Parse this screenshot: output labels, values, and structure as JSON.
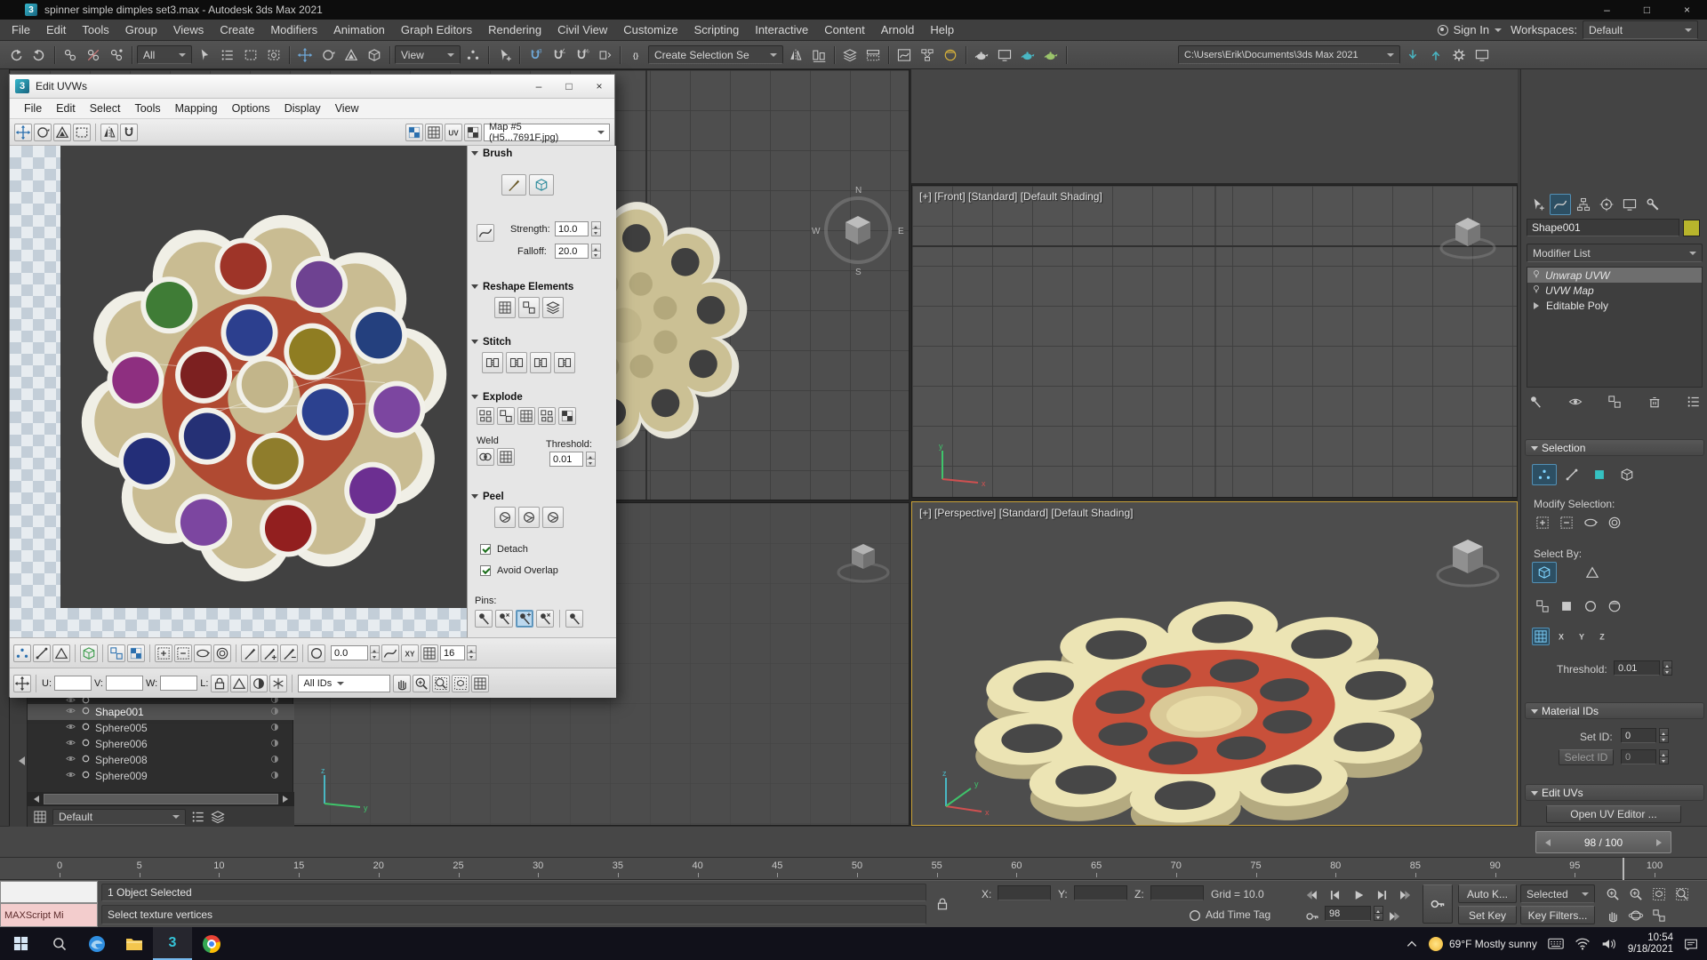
{
  "window_controls": {
    "minimize": "–",
    "maximize": "□",
    "close": "×"
  },
  "titlebar": {
    "title": "spinner simple dimples set3.max - Autodesk 3ds Max 2021",
    "app_badge": "3"
  },
  "menubar": {
    "items": [
      "File",
      "Edit",
      "Tools",
      "Group",
      "Views",
      "Create",
      "Modifiers",
      "Animation",
      "Graph Editors",
      "Rendering",
      "Civil View",
      "Customize",
      "Scripting",
      "Interactive",
      "Content",
      "Arnold",
      "Help"
    ],
    "sign_in": "Sign In",
    "workspaces_label": "Workspaces:",
    "workspaces_value": "Default"
  },
  "toolbar": {
    "filter_value": "All",
    "coord_value": "View",
    "named_sel_value": "Create Selection Se",
    "path_value": "C:\\Users\\Erik\\Documents\\3ds Max 2021",
    "strip_a": [
      {
        "n": "undo-icon",
        "g": "undo"
      },
      {
        "n": "redo-icon",
        "g": "redo"
      },
      {
        "sep": 1
      },
      {
        "n": "select-and-link-icon",
        "g": "chain"
      },
      {
        "n": "unlink-selection-icon",
        "g": "chainx"
      },
      {
        "n": "bind-spacewarp-icon",
        "g": "chaindot"
      },
      {
        "sep": 1
      }
    ],
    "strip_b": [
      {
        "n": "select-object-icon",
        "g": "cursor"
      },
      {
        "n": "select-by-name-icon",
        "g": "list3"
      },
      {
        "n": "rect-region-icon",
        "g": "rectdash"
      },
      {
        "n": "crossing-region-icon",
        "g": "rectcross"
      },
      {
        "sep": 1
      },
      {
        "n": "select-move-icon",
        "g": "move",
        "c": "#6fa8d8"
      },
      {
        "n": "select-rotate-icon",
        "g": "rotate"
      },
      {
        "n": "select-scale-icon",
        "g": "scale"
      },
      {
        "n": "select-place-icon",
        "g": "cube"
      },
      {
        "sep": 1
      }
    ],
    "strip_c": [
      {
        "n": "use-center-icon",
        "g": "dots3"
      },
      {
        "sep": 1
      },
      {
        "n": "select-manipulate-icon",
        "g": "cursorplus"
      },
      {
        "sep": 1
      },
      {
        "n": "snap-3d-icon",
        "g": "magnet",
        "t": "3",
        "c": "#6fa8d8"
      },
      {
        "n": "angle-snap-icon",
        "g": "magnet",
        "t": "∠"
      },
      {
        "n": "percent-snap-icon",
        "g": "magnet",
        "t": "%"
      },
      {
        "n": "spinner-snap-icon",
        "g": "spinner"
      },
      {
        "sep": 1
      },
      {
        "n": "edit-named-selections-icon",
        "g": "txt",
        "t": "{}"
      }
    ],
    "strip_d": [
      {
        "n": "mirror-icon",
        "g": "mirror"
      },
      {
        "n": "align-icon",
        "g": "align"
      },
      {
        "sep": 1
      },
      {
        "n": "layer-explorer-icon",
        "g": "layers"
      },
      {
        "n": "toggle-ribbon-icon",
        "g": "ribbon"
      },
      {
        "sep": 1
      },
      {
        "n": "curve-editor-icon",
        "g": "graph"
      },
      {
        "n": "schematic-view-icon",
        "g": "schematic"
      },
      {
        "n": "material-editor-icon",
        "g": "matsphere",
        "c": "#d8b23a"
      },
      {
        "sep": 1
      },
      {
        "n": "render-setup-icon",
        "g": "teapot"
      },
      {
        "n": "rendered-frame-window-icon",
        "g": "screen"
      },
      {
        "n": "render-production-icon",
        "g": "teapot",
        "c": "#49b7c4"
      },
      {
        "n": "render-iterative-icon",
        "g": "teapot",
        "c": "#9bc46b"
      },
      {
        "sep": 1
      }
    ],
    "strip_e": [
      {
        "n": "asset-library-icon",
        "g": "arrowd",
        "c": "#49b7c4"
      },
      {
        "n": "cloud-sync-icon",
        "g": "arrowu",
        "c": "#49b7c4"
      },
      {
        "n": "preferences-icon",
        "g": "gear"
      },
      {
        "n": "display-monitor-icon",
        "g": "screen"
      }
    ]
  },
  "viewports": {
    "front_label": "[+] [Front] [Standard] [Default Shading]",
    "persp_label": "[+] [Perspective] [Standard] [Default Shading]",
    "compass": {
      "n": "N",
      "e": "E",
      "s": "S",
      "w": "W"
    },
    "axis": {
      "x": "x",
      "y": "y",
      "z": "z"
    }
  },
  "edit_uvws": {
    "title": "Edit UVWs",
    "menus": [
      "File",
      "Edit",
      "Select",
      "Tools",
      "Mapping",
      "Options",
      "Display",
      "View"
    ],
    "map_value": "Map #5 (H5...7691F.jpg)",
    "tools_left": [
      {
        "n": "uv-move-icon",
        "g": "move",
        "c": "#2a6fae"
      },
      {
        "n": "uv-rotate-icon",
        "g": "rotate"
      },
      {
        "n": "uv-scale-icon",
        "g": "scale"
      },
      {
        "n": "uv-freeform-icon",
        "g": "rectdash"
      },
      {
        "sep": 1
      },
      {
        "n": "uv-mirror-icon",
        "g": "mirror"
      },
      {
        "n": "uv-snap-icon",
        "g": "magnet"
      }
    ],
    "tools_right": [
      {
        "n": "show-map-toggle-icon",
        "g": "checker",
        "c": "#2a6fae"
      },
      {
        "n": "uv-grid-toggle-icon",
        "g": "grid9"
      },
      {
        "n": "uv-space-button",
        "g": "txt",
        "t": "UV"
      },
      {
        "n": "texture-checker-icon",
        "g": "checker"
      }
    ],
    "brush": {
      "title": "Brush",
      "icons": [
        {
          "n": "move-brush-icon",
          "g": "brush",
          "c": "#6a5a2a"
        },
        {
          "n": "relax-brush-icon",
          "g": "cube",
          "c": "#2a8a9b"
        }
      ],
      "falloff_icon": [
        {
          "n": "brush-falloff-curve-icon",
          "g": "curve"
        }
      ],
      "strength_label": "Strength:",
      "strength_value": "10.0",
      "falloff_label": "Falloff:",
      "falloff_value": "20.0"
    },
    "reshape": {
      "title": "Reshape Elements",
      "icons": [
        {
          "n": "straighten-selection-icon",
          "g": "grid9"
        },
        {
          "n": "relax-until-flat-icon",
          "g": "cubes"
        },
        {
          "n": "relax-tool-icon",
          "g": "layers"
        }
      ]
    },
    "stitch": {
      "title": "Stitch",
      "icons": [
        {
          "n": "stitch-custom-icon",
          "g": "stitch"
        },
        {
          "n": "stitch-average-icon",
          "g": "stitch"
        },
        {
          "n": "stitch-source-icon",
          "g": "stitch"
        },
        {
          "n": "stitch-target-icon",
          "g": "stitch"
        }
      ]
    },
    "explode": {
      "title": "Explode",
      "icons": [
        {
          "n": "break-by-angle-icon",
          "g": "explode"
        },
        {
          "n": "break-icon",
          "g": "cubes"
        },
        {
          "n": "detach-icon",
          "g": "grid9"
        },
        {
          "n": "flatten-by-angle-icon",
          "g": "explode"
        },
        {
          "n": "flatten-by-smoothing-icon",
          "g": "checker"
        }
      ],
      "weld_label": "Weld",
      "weld_icons": [
        {
          "n": "weld-custom-icon",
          "g": "weld"
        },
        {
          "n": "target-weld-icon",
          "g": "grid9"
        }
      ],
      "threshold_label": "Threshold:",
      "threshold_value": "0.01"
    },
    "peel": {
      "title": "Peel",
      "icons": [
        {
          "n": "quick-peel-icon",
          "g": "peel"
        },
        {
          "n": "peel-mode-icon",
          "g": "peel"
        },
        {
          "n": "pelt-map-icon",
          "g": "peel"
        }
      ],
      "detach_label": "Detach",
      "avoid_label": "Avoid Overlap",
      "pins_label": "Pins:",
      "pins_icons": [
        {
          "n": "pin-tool-icon",
          "g": "pin"
        },
        {
          "n": "unpin-tool-icon",
          "g": "pinx"
        },
        {
          "n": "auto-pin-icon",
          "g": "pinplus",
          "active": true
        },
        {
          "n": "clear-pins-icon",
          "g": "pinx"
        },
        {
          "sep": 1
        },
        {
          "n": "pin-options-icon",
          "g": "pin"
        }
      ]
    },
    "row_a1": [
      {
        "n": "uv-vertex-mode-icon",
        "g": "dots3",
        "c": "#2a6fae"
      },
      {
        "n": "uv-edge-mode-icon",
        "g": "edge"
      },
      {
        "n": "uv-face-mode-icon",
        "g": "tri"
      },
      {
        "sep": 1
      },
      {
        "n": "uv-element-mode-icon",
        "g": "cube",
        "c": "#3a9b4a"
      },
      {
        "sep": 1
      },
      {
        "n": "select-by-element-uv-icon",
        "g": "cubes",
        "c": "#2a6fae"
      },
      {
        "n": "sync-to-viewport-icon",
        "g": "checker",
        "c": "#2a6fae"
      },
      {
        "sep": 1
      },
      {
        "n": "grow-uv-selection-icon",
        "g": "plusbox"
      },
      {
        "n": "shrink-uv-selection-icon",
        "g": "minusbox"
      },
      {
        "n": "uv-edge-loop-icon",
        "g": "loop"
      },
      {
        "n": "uv-edge-ring-icon",
        "g": "ring"
      },
      {
        "sep": 1
      },
      {
        "n": "paint-select-icon",
        "g": "brush"
      },
      {
        "n": "paint-select-add-icon",
        "g": "brushplus"
      },
      {
        "n": "paint-select-sub-icon",
        "g": "brushminus"
      },
      {
        "sep": 1
      },
      {
        "n": "soft-selection-icon",
        "g": "circ"
      }
    ],
    "row_a2": [
      {
        "n": "falloff-curve-icon",
        "g": "curve"
      },
      {
        "n": "falloff-space-button",
        "g": "txt",
        "t": "XY"
      },
      {
        "n": "limit-soft-selection-icon",
        "g": "grid9"
      }
    ],
    "angle_value": "0.0",
    "grid_value": "16",
    "row_b1": [
      {
        "n": "absolute-typein-icon",
        "g": "move"
      },
      {
        "sep": 1
      }
    ],
    "u_label": "U:",
    "v_label": "V:",
    "w_label": "W:",
    "l_label": "L:",
    "row_b2": [
      {
        "n": "lock-selected-icon",
        "g": "lock"
      },
      {
        "n": "filter-selected-faces-icon",
        "g": "tri"
      },
      {
        "n": "hide-selected-icon",
        "g": "halfdisc"
      },
      {
        "n": "freeze-selected-icon",
        "g": "snow"
      },
      {
        "sep": 1
      }
    ],
    "ids_value": "All IDs",
    "row_b3": [
      {
        "n": "pan-view-icon",
        "g": "hand"
      },
      {
        "n": "zoom-view-icon",
        "g": "zoomplus"
      },
      {
        "n": "zoom-region-icon",
        "g": "zoomregion"
      },
      {
        "n": "zoom-extents-icon",
        "g": "zoomext"
      },
      {
        "n": "snap-grid-icon",
        "g": "grid9"
      }
    ]
  },
  "scene_explorer": {
    "rows": [
      {
        "name": "",
        "clipped": true
      },
      {
        "name": "Shape001",
        "selected": true
      },
      {
        "name": "Sphere005"
      },
      {
        "name": "Sphere006"
      },
      {
        "name": "Sphere008"
      },
      {
        "name": "Sphere009"
      }
    ],
    "footer_value": "Default",
    "footer_icons": [
      {
        "n": "explorer-sort-icon",
        "g": "list3"
      },
      {
        "n": "explorer-display-icon",
        "g": "layers"
      }
    ],
    "config_icon": [
      {
        "n": "explorer-config-icon",
        "g": "grid9"
      }
    ]
  },
  "command_panel": {
    "tabs": [
      {
        "n": "tab-create",
        "g": "cursorplus"
      },
      {
        "n": "tab-modify",
        "g": "curve",
        "active": true
      },
      {
        "n": "tab-hierarchy",
        "g": "hierarchy"
      },
      {
        "n": "tab-motion",
        "g": "motion"
      },
      {
        "n": "tab-display",
        "g": "screen"
      },
      {
        "n": "tab-utilities",
        "g": "wrench"
      }
    ],
    "object_name": "Shape001",
    "swatch_color": "#b8b52c",
    "modifier_list_label": "Modifier List",
    "stack": [
      {
        "name": "Unwrap UVW",
        "italic": true,
        "selected": true
      },
      {
        "name": "UVW Map",
        "italic": true
      },
      {
        "name": "Editable Poly",
        "expandable": true
      }
    ],
    "stack_tools": [
      {
        "n": "pin-stack-icon",
        "g": "pin"
      },
      {
        "n": "show-end-result-icon",
        "g": "eye"
      },
      {
        "n": "make-unique-icon",
        "g": "cubes"
      },
      {
        "n": "remove-modifier-icon",
        "g": "trash"
      },
      {
        "n": "configure-modifier-sets-icon",
        "g": "list3"
      }
    ],
    "selection": {
      "title": "Selection",
      "row1": [
        {
          "n": "vertex-subobject-icon",
          "g": "dots3",
          "c": "#7fd4ff",
          "active": true
        },
        {
          "n": "edge-subobject-icon",
          "g": "edge"
        },
        {
          "n": "polygon-subobject-icon",
          "g": "sq",
          "c": "#35c2c2"
        },
        {
          "n": "element-subobject-icon",
          "g": "cube"
        }
      ],
      "modify_label": "Modify Selection:",
      "row2": [
        {
          "n": "grow-selection-icon",
          "g": "plusbox"
        },
        {
          "n": "shrink-selection-icon",
          "g": "minusbox"
        },
        {
          "n": "edge-loop-icon",
          "g": "loop"
        },
        {
          "n": "edge-ring-icon",
          "g": "ring"
        }
      ],
      "select_by_label": "Select By:",
      "row3": [
        {
          "n": "select-by-element-toggle-icon",
          "g": "cube",
          "c": "#7fd4ff",
          "active": true
        },
        {
          "n": "planar-angle-toggle-icon",
          "g": "tri"
        }
      ],
      "row4": [
        {
          "n": "ignore-backfacing-icon",
          "g": "cubes"
        },
        {
          "n": "select-by-id-icon",
          "g": "sq"
        },
        {
          "n": "select-by-smoothing-icon",
          "g": "circ"
        },
        {
          "n": "select-by-map-icon",
          "g": "matsphere"
        }
      ],
      "xyz_chips": [
        {
          "n": "planar-constraint-icon",
          "g": "grid9",
          "c": "#7fd4ff",
          "active": true
        },
        {
          "n": "x-axis-button",
          "g": "txt",
          "t": "X"
        },
        {
          "n": "y-axis-button",
          "g": "txt",
          "t": "Y"
        },
        {
          "n": "z-axis-button",
          "g": "txt",
          "t": "Z"
        }
      ],
      "threshold_label": "Threshold:",
      "threshold_value": "0.01"
    },
    "material_ids": {
      "title": "Material IDs",
      "set_id_label": "Set ID:",
      "set_id_value": "0",
      "select_id_label": "Select ID",
      "select_id_value": "0"
    },
    "edit_uvs": {
      "title": "Edit UVs",
      "open_button": "Open UV Editor ..."
    }
  },
  "timeline": {
    "slider_value": "98 / 100",
    "ticks": [
      0,
      5,
      10,
      15,
      20,
      25,
      30,
      35,
      40,
      45,
      50,
      55,
      60,
      65,
      70,
      75,
      80,
      85,
      90,
      95,
      100
    ]
  },
  "status": {
    "maxscript_label": "MAXScript Mi",
    "selected_info": "1 Object Selected",
    "prompt": "Select texture vertices",
    "x_label": "X:",
    "y_label": "Y:",
    "z_label": "Z:",
    "grid_label": "Grid = 10.0",
    "time_tag_label": "Add Time Tag",
    "auto_key_label": "Auto K...",
    "selected_label": "Selected",
    "set_key_label": "Set Key",
    "key_filters_label": "Key Filters...",
    "frame_value": "98",
    "transport1": [
      {
        "n": "go-to-start-button",
        "g": "endb"
      },
      {
        "n": "previous-frame-button",
        "g": "stepb"
      },
      {
        "n": "play-button",
        "g": "play"
      },
      {
        "n": "next-frame-button",
        "g": "stepf"
      },
      {
        "n": "go-to-end-button",
        "g": "endf"
      }
    ],
    "key_mode": [
      {
        "n": "key-mode-button",
        "g": "key"
      }
    ],
    "end2": [
      {
        "n": "go-to-end-button-2",
        "g": "endf"
      }
    ],
    "time_tag_icon": [
      {
        "n": "time-tag-icon",
        "g": "circ"
      }
    ],
    "lock_icon": [
      {
        "n": "selection-lock-icon",
        "g": "lock"
      }
    ],
    "nav1": [
      {
        "n": "zoom-button",
        "g": "zoomplus"
      },
      {
        "n": "zoom-all-button",
        "g": "zoomplus"
      },
      {
        "n": "zoom-extents-button",
        "g": "zoomext"
      },
      {
        "n": "zoom-region-button",
        "g": "zoomregion"
      }
    ],
    "nav2": [
      {
        "n": "pan-button",
        "g": "hand"
      },
      {
        "n": "orbit-button",
        "g": "orbit"
      },
      {
        "n": "maximize-viewport-button",
        "g": "maximize"
      }
    ]
  },
  "taskbar": {
    "weather": "69°F Mostly sunny",
    "time": "10:54",
    "date": "9/18/2021",
    "app_badge": "3"
  },
  "artwork": {
    "uv_flower": {
      "body": "#c9bc92",
      "outline": "#f0efe6",
      "ring": "#b04a32",
      "center": "#c2b58a",
      "circle_ring": "#f2f1ea",
      "wires": [
        [
          -130,
          -40,
          140,
          -18
        ],
        [
          -95,
          28,
          150,
          -48
        ],
        [
          -60,
          12,
          128,
          6
        ]
      ],
      "circles": [
        [
          -24,
          -153,
          "#9e3428"
        ],
        [
          64,
          -132,
          "#6e4291"
        ],
        [
          -110,
          -108,
          "#3f7c36"
        ],
        [
          133,
          -73,
          "#24407e"
        ],
        [
          -17,
          -76,
          "#2c3f8e"
        ],
        [
          56,
          -54,
          "#8f7d22"
        ],
        [
          -149,
          -21,
          "#8e2f80"
        ],
        [
          -70,
          -27,
          "#7c2020"
        ],
        [
          71,
          16,
          "#2c418f"
        ],
        [
          154,
          13,
          "#7c46a0"
        ],
        [
          -136,
          73,
          "#232e78"
        ],
        [
          -66,
          44,
          "#253075"
        ],
        [
          13,
          73,
          "#8f7d2c"
        ],
        [
          126,
          107,
          "#6c2f91"
        ],
        [
          -70,
          144,
          "#7c46a0"
        ],
        [
          28,
          151,
          "#921f1f"
        ]
      ]
    },
    "persp_flower": {
      "body": "#ece4b4",
      "side": "#b4aa80",
      "ring": "#c8503a",
      "ring_side": "#9c3c2b",
      "hole": "#474747",
      "center": "#d9c997",
      "center_top": "#e8dca8"
    },
    "top_flower": {
      "body": "#cbc094",
      "outline": "#e8e6da",
      "hole": "#3f3f3f",
      "dimple": "#b3a87c",
      "center": "#c1b68a"
    }
  }
}
